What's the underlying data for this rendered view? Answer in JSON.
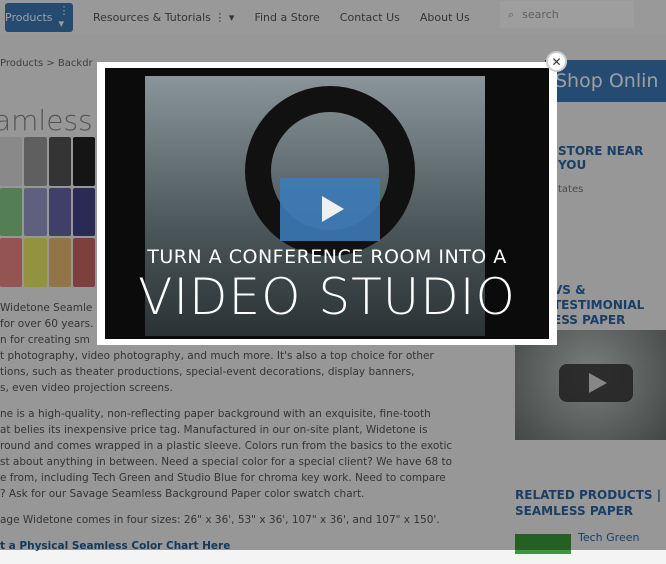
{
  "nav": {
    "products": "Products",
    "resources": "Resources & Tutorials",
    "find_store": "Find a Store",
    "contact": "Contact Us",
    "about": "About Us",
    "search_placeholder": "search"
  },
  "breadcrumb": "Products  >  Backdr",
  "page_title": "amless P",
  "body": {
    "p1": [
      "Widetone Seamle",
      "for over 60 years.",
      "n for creating sm",
      "t photography, video photography, and much more. It's also a top choice for other",
      "tions, such as theater productions, special-event decorations, display banners,",
      "s, even video projection screens."
    ],
    "p2": [
      "ne is a high-quality, non-reflecting paper background with an exquisite, fine-tooth",
      "at belies its inexpensive price tag. Manufactured in our on-site plant, Widetone is",
      "round and comes wrapped in a plastic sleeve. Colors run from the basics to the exotic",
      "st about anything in between. Need a special color for a special client? We have 68 to",
      "e from, including Tech Green and Studio Blue for chroma key work. Need to compare",
      "? Ask for our Savage Seamless Background Paper color swatch chart."
    ],
    "p3": "age Widetone comes in four sizes: 26\" x 36', 53\" x 36', 107\" x 36', and 107\" x 150'.",
    "link": "t a Physical Seamless Color Chart Here"
  },
  "sidebar": {
    "shop": "Shop Onlin",
    "store_head": "STORE NEAR YOU",
    "country": "tates",
    "testimonials_1": "VS & TESTIMONIAL",
    "testimonials_2": "ESS PAPER",
    "related_1": "RELATED PRODUCTS  |",
    "related_2": "SEAMLESS PAPER",
    "related_item": "Tech Green"
  },
  "video": {
    "line1": "TURN A CONFERENCE ROOM INTO A",
    "line2": "VIDEO STUDIO"
  },
  "colors": {
    "accent": "#3d7ab8"
  }
}
